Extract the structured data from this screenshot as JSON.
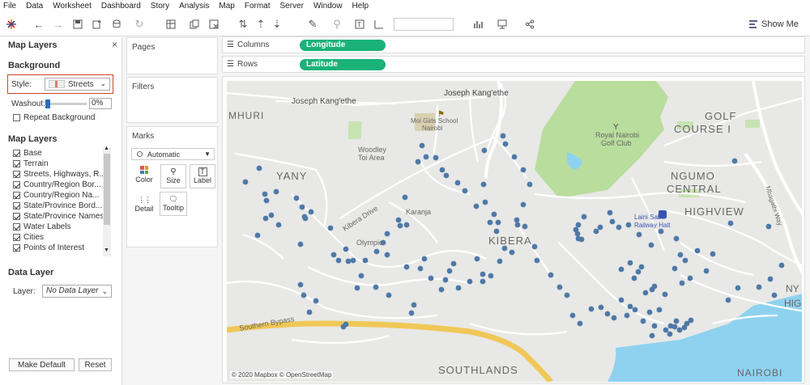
{
  "menu": [
    "File",
    "Data",
    "Worksheet",
    "Dashboard",
    "Story",
    "Analysis",
    "Map",
    "Format",
    "Server",
    "Window",
    "Help"
  ],
  "toolbar": {
    "show_me": "Show Me"
  },
  "left_panel": {
    "title": "Map Layers",
    "background_heading": "Background",
    "style_label": "Style:",
    "style_value": "Streets",
    "washout_label": "Washout:",
    "washout_value": "0%",
    "repeat_background": "Repeat Background",
    "map_layers_heading": "Map Layers",
    "layers": [
      {
        "label": "Base",
        "checked": true
      },
      {
        "label": "Terrain",
        "checked": true
      },
      {
        "label": "Streets, Highways, R...",
        "checked": true
      },
      {
        "label": "Country/Region Bor...",
        "checked": true
      },
      {
        "label": "Country/Region Na...",
        "checked": true
      },
      {
        "label": "State/Province Bord...",
        "checked": true
      },
      {
        "label": "State/Province Names",
        "checked": true
      },
      {
        "label": "Water Labels",
        "checked": true
      },
      {
        "label": "Cities",
        "checked": true
      },
      {
        "label": "Points of Interest",
        "checked": true
      }
    ],
    "data_layer_heading": "Data Layer",
    "layer_label": "Layer:",
    "layer_value": "No Data Layer",
    "make_default": "Make Default",
    "reset": "Reset"
  },
  "cards": {
    "pages": "Pages",
    "filters": "Filters",
    "marks": "Marks",
    "mark_type": "Automatic",
    "mark_buttons": [
      "Color",
      "Size",
      "Label",
      "Detail",
      "Tooltip"
    ]
  },
  "shelves": {
    "columns_label": "Columns",
    "columns_pill": "Longitude",
    "rows_label": "Rows",
    "rows_pill": "Latitude"
  },
  "map": {
    "labels": [
      "Joseph Kang'ethe",
      "Joseph Kang'ethe",
      "Moi Girls School",
      "Nairobi",
      "Woodley",
      "Toi Area",
      "Royal Nairobi",
      "Golf Club",
      "GOLF",
      "COURSE I",
      "NGUMO",
      "CENTRAL",
      "HIGHVIEW",
      "Kibera Drive",
      "KIBERA",
      "Laini Saba",
      "Railway Halt",
      "Mbagathi Way",
      "Southern Bypass",
      "SOUTHLANDS",
      "MHURI",
      "YANY",
      "Karanja",
      "Olympic",
      "NAIROBI",
      "NY",
      "HIGI"
    ],
    "attribution": "© 2020 Mapbox © OpenStreetMap",
    "colors": {
      "marks": "#4e79a7",
      "park": "#b9dd9d",
      "water": "#8ed2f0",
      "road_major": "#f6d56a",
      "road": "#ffffff"
    }
  }
}
